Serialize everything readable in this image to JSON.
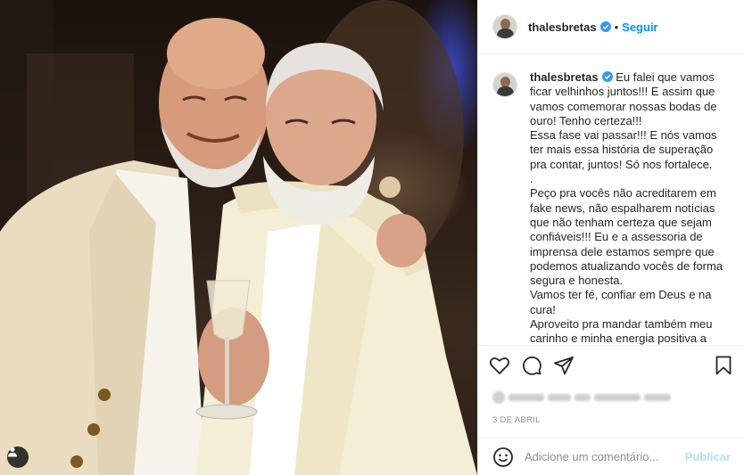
{
  "post": {
    "username": "thalesbretas",
    "follow_label": "Seguir",
    "separator": "•",
    "more_label": "•••",
    "caption": "Eu falei que vamos ficar velhinhos juntos!!! E assim que vamos comemorar nossas bodas de ouro! Tenho certeza!!!\nEssa fase vai passar!!! E nós vamos ter mais essa história de superação pra contar, juntos! Só nos fortalece.\n.\nPeço pra vocês não acreditarem em fake news, não espalharem notícias que não tenham certeza que sejam confiáveis!!! Eu e a assessoria de imprensa dele estamos sempre que podemos atualizando vocês de forma segura e honesta.\nVamos ter fé, confiar em Deus e na cura!\nAproveito pra mandar também meu carinho e minha energia positiva a",
    "date": "3 DE ABRIL"
  },
  "comment": {
    "placeholder": "Adicione um comentário...",
    "publish_label": "Publicar"
  },
  "icons": {
    "verified": "verified-badge-icon",
    "like": "heart-icon",
    "comment": "comment-icon",
    "share": "share-icon",
    "save": "bookmark-icon",
    "emoji": "emoji-icon",
    "user_tag": "user-tag-icon"
  },
  "colors": {
    "accent": "#0095f6",
    "publish_disabled": "#b2dffc",
    "muted": "#8e8e8e",
    "border": "#efefef"
  }
}
